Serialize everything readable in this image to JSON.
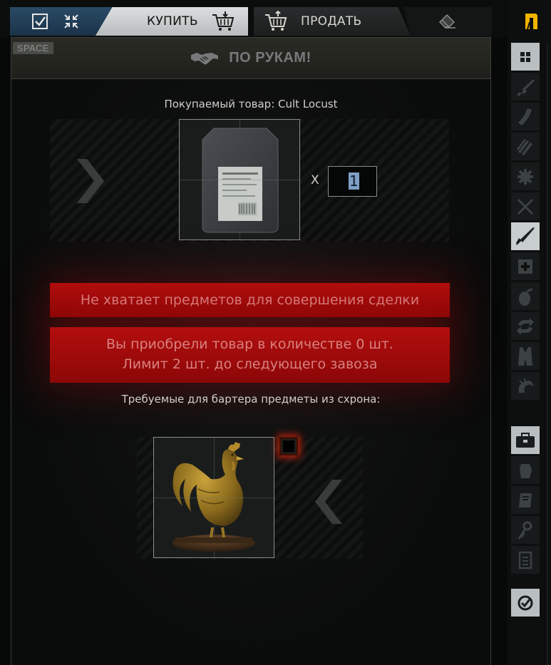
{
  "tabs": {
    "buy_label": "КУПИТЬ",
    "sell_label": "ПРОДАТЬ"
  },
  "deal": {
    "hotkey": "SPACE",
    "label": "ПО РУКАМ!"
  },
  "purchase": {
    "title": "Покупаемый товар: Cult Locust",
    "quantity_prefix": "X",
    "quantity": "1"
  },
  "warnings": {
    "not_enough": "Не хватает предметов для совершения сделки",
    "limit_line1": "Вы приобрели товар в количестве 0 шт.",
    "limit_line2": "Лимит 2 шт. до следующего завоза"
  },
  "barter": {
    "title": "Требуемые для бартера предметы из схрона:"
  },
  "sidebar": {
    "categories": [
      "grid-icon",
      "rifle-icon",
      "magazine-icon",
      "ammo-icon",
      "gear-cog-icon",
      "crossed-tools-icon",
      "knife-icon",
      "medkit-icon",
      "grenade-icon",
      "swap-icon",
      "vest-icon",
      "fast-travel-icon",
      "briefcase-icon",
      "glove-icon",
      "book-icon",
      "keys-icon",
      "document-icon",
      "checkmark-icon"
    ]
  },
  "colors": {
    "warning_red": "#a80c0c",
    "buy_tab": "#cfd3d4",
    "icons_tab": "#244260",
    "rouble_accent": "#f0b400"
  }
}
